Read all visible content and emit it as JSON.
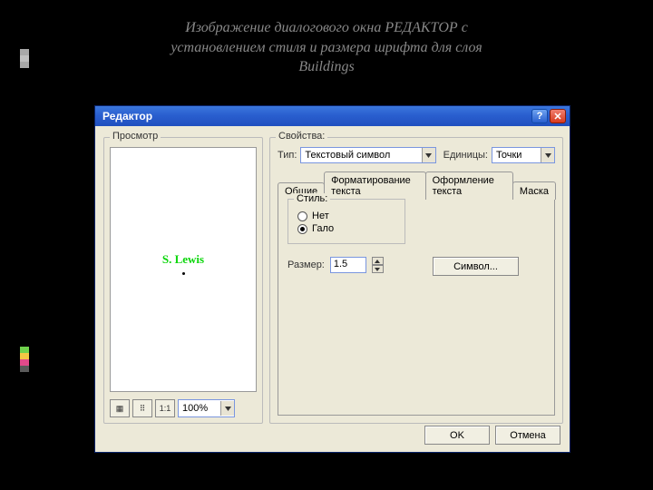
{
  "caption": {
    "line1": "Изображение диалогового окна РЕДАКТОР с",
    "line2": "установлением стиля и размера шрифта для слоя",
    "line3": "Buildings"
  },
  "accent_colors": [
    "#a8a8a8",
    "#bfbfbf",
    "#a8a8a8"
  ],
  "accent_colors2": [
    "#6fd14c",
    "#f2c744",
    "#e24a8a",
    "#5a5a5a"
  ],
  "dialog": {
    "title": "Редактор",
    "help": "?",
    "close": "✕",
    "ok": "OK",
    "cancel": "Отмена"
  },
  "preview": {
    "legend": "Просмотр",
    "sample": "S. Lewis",
    "zoom": "100%"
  },
  "properties": {
    "legend": "Свойства:",
    "type_label": "Тип:",
    "type_value": "Текстовый символ",
    "units_label": "Единицы:",
    "units_value": "Точки"
  },
  "tabs": [
    "Общие",
    "Форматирование текста",
    "Оформление текста",
    "Маска"
  ],
  "mask": {
    "style_legend": "Стиль:",
    "none_label": "Нет",
    "halo_label": "Гало",
    "selected": "halo",
    "size_label": "Размер:",
    "size_value": "1.5",
    "symbol_button": "Символ..."
  }
}
